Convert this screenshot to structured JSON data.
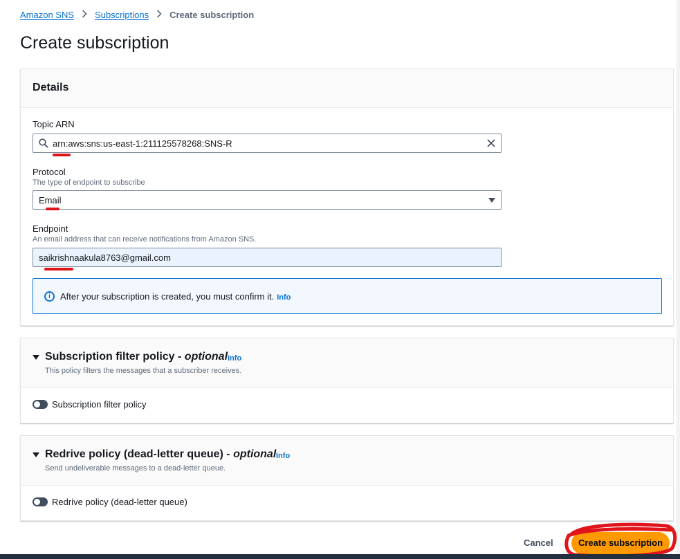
{
  "breadcrumb": {
    "items": [
      {
        "label": "Amazon SNS"
      },
      {
        "label": "Subscriptions"
      }
    ],
    "current": "Create subscription",
    "separator": ">"
  },
  "page": {
    "title": "Create subscription"
  },
  "details": {
    "title": "Details",
    "topic_arn": {
      "label": "Topic ARN",
      "value": "arn:aws:sns:us-east-1:211125578268:SNS-R"
    },
    "protocol": {
      "label": "Protocol",
      "description": "The type of endpoint to subscribe",
      "selected": "Email"
    },
    "endpoint": {
      "label": "Endpoint",
      "description": "An email address that can receive notifications from Amazon SNS.",
      "value": "saikrishnaakula8763@gmail.com"
    },
    "alert": {
      "text": "After your subscription is created, you must confirm it.",
      "link": "Info",
      "icon": "info-circle-icon"
    }
  },
  "filter_policy": {
    "title": "Subscription filter policy - ",
    "optional": "optional",
    "info": "Info",
    "description": "This policy filters the messages that a subscriber receives.",
    "toggle_label": "Subscription filter policy",
    "toggle_on": false
  },
  "redrive_policy": {
    "title": "Redrive policy (dead-letter queue) - ",
    "optional": "optional",
    "info": "Info",
    "description": "Send undeliverable messages to a dead-letter queue.",
    "toggle_label": "Redrive policy (dead-letter queue)",
    "toggle_on": false
  },
  "actions": {
    "cancel": "Cancel",
    "create": "Create subscription"
  },
  "colors": {
    "link": "#0972d3",
    "primary_button": "#ff9900",
    "annotation": "#e0151c"
  }
}
